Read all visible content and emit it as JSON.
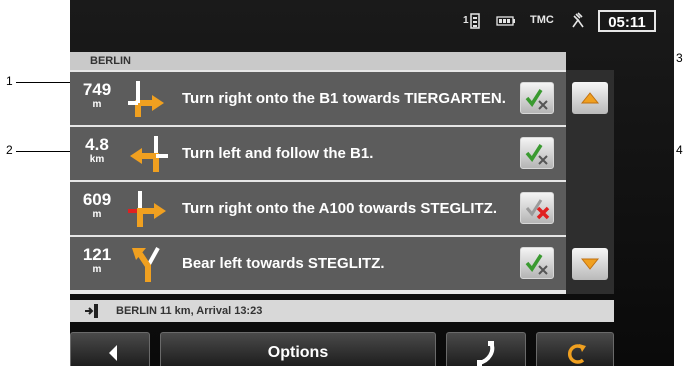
{
  "status": {
    "gps_signal_label": "1",
    "tmc_label": "TMC",
    "time": "05:11"
  },
  "route": {
    "destination_header": "BERLIN",
    "maneuvers": [
      {
        "distance": "749",
        "unit": "m",
        "instruction": "Turn right onto the B1 towards TIERGARTEN.",
        "arrow_icon": "turn-right-arrow-icon",
        "blocked": false
      },
      {
        "distance": "4.8",
        "unit": "km",
        "instruction": "Turn left and follow the B1.",
        "arrow_icon": "turn-left-arrow-icon",
        "blocked": false
      },
      {
        "distance": "609",
        "unit": "m",
        "instruction": "Turn right onto the A100 towards STEGLITZ.",
        "arrow_icon": "turn-right-arrow-icon",
        "blocked": true
      },
      {
        "distance": "121",
        "unit": "m",
        "instruction": "Bear left towards STEGLITZ.",
        "arrow_icon": "bear-left-arrow-icon",
        "blocked": false
      }
    ]
  },
  "arrival_info": "BERLIN 11 km, Arrival 13:23",
  "footer": {
    "options_label": "Options"
  },
  "callouts": [
    "1",
    "2",
    "3",
    "4"
  ],
  "colors": {
    "accent_orange": "#f0a020",
    "blocked_red": "#e02020",
    "check_green": "#3a9a30"
  }
}
